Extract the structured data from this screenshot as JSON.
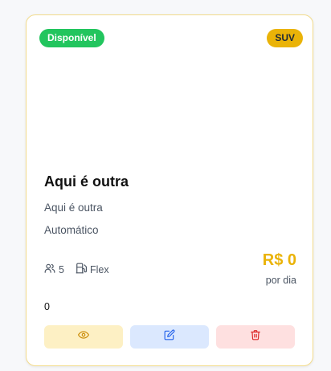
{
  "card": {
    "status_badge": "Disponível",
    "type_badge": "SUV",
    "title": "Aqui é outra",
    "description": "Aqui é outra",
    "transmission": "Automático",
    "seats": "5",
    "fuel": "Flex",
    "price": "R$ 0",
    "price_unit": "por dia",
    "count": "0",
    "actions": {
      "view_icon": "eye-icon",
      "edit_icon": "edit-icon",
      "delete_icon": "trash-icon"
    }
  },
  "colors": {
    "status": "#22c55e",
    "accent": "#eab308",
    "view_bg": "#fdf0c4",
    "edit_bg": "#dbe8fe",
    "delete_bg": "#fee0e0"
  }
}
